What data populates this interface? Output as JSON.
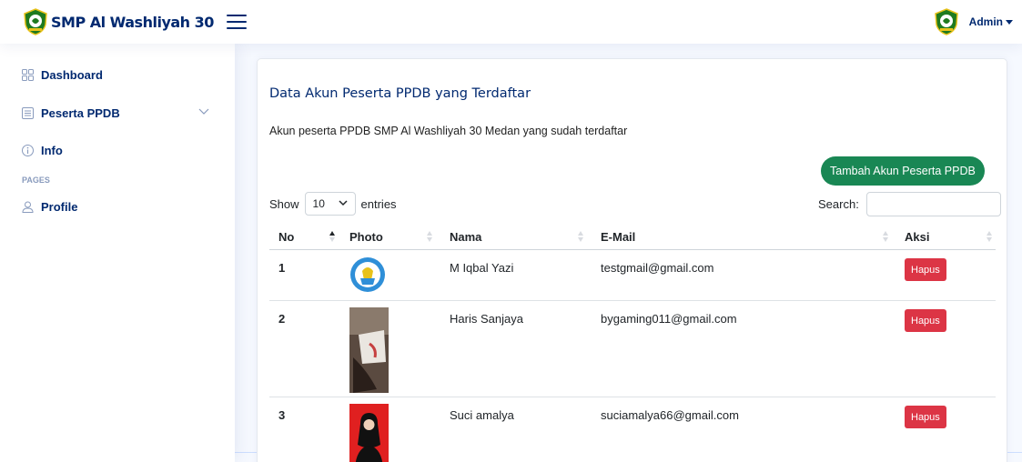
{
  "header": {
    "brand": "SMP Al Washliyah 30",
    "user_name": "Admin"
  },
  "sidebar": {
    "items": [
      {
        "label": "Dashboard",
        "icon": "grid-icon"
      },
      {
        "label": "Peserta PPDB",
        "icon": "menu-button-icon"
      },
      {
        "label": "Info",
        "icon": "info-circle-icon"
      }
    ],
    "section_heading": "PAGES",
    "pages": [
      {
        "label": "Profile",
        "icon": "person-icon"
      }
    ]
  },
  "card": {
    "title": "Data Akun Peserta PPDB yang Terdaftar",
    "description": "Akun peserta PPDB SMP Al Washliyah 30 Medan yang sudah terdaftar",
    "add_button": "Tambah Akun Peserta PPDB"
  },
  "table_controls": {
    "show_label": "Show",
    "entries_value": "10",
    "entries_label": "entries",
    "search_label": "Search:"
  },
  "table": {
    "headers": [
      "No",
      "Photo",
      "Nama",
      "E-Mail",
      "Aksi"
    ],
    "rows": [
      {
        "no": "1",
        "photo": "school-logo-icon",
        "nama": "M Iqbal Yazi",
        "email": "testgmail@gmail.com",
        "action": "Hapus"
      },
      {
        "no": "2",
        "photo": "student-photo",
        "nama": "Haris Sanjaya",
        "email": "bygaming011@gmail.com",
        "action": "Hapus"
      },
      {
        "no": "3",
        "photo": "student-photo",
        "nama": "Suci amalya",
        "email": "suciamalya66@gmail.com",
        "action": "Hapus"
      }
    ]
  },
  "colors": {
    "primary_text": "#012970",
    "accent_green": "#198754",
    "danger_red": "#dc3545",
    "page_bg": "#f6f9ff"
  }
}
